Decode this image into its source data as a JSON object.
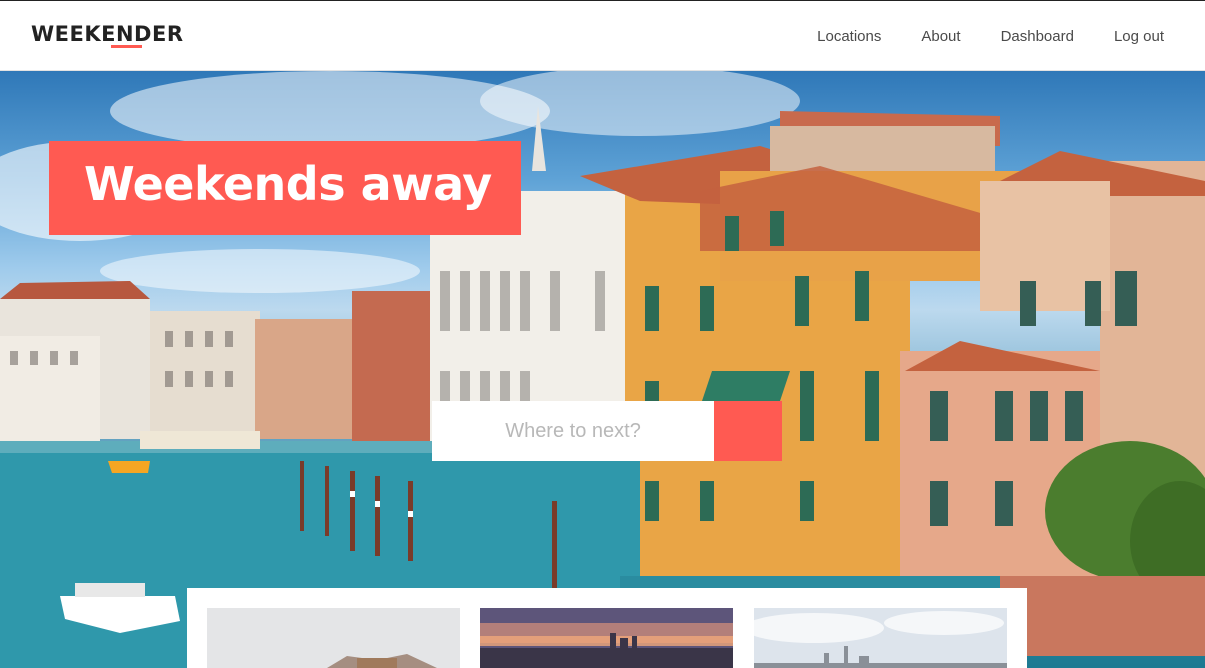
{
  "brand": {
    "name": "WEEKENDER",
    "accent": "#ff5a52"
  },
  "nav": [
    {
      "label": "Locations"
    },
    {
      "label": "About"
    },
    {
      "label": "Dashboard"
    },
    {
      "label": "Log out"
    }
  ],
  "hero": {
    "headline": "Weekends away",
    "search_placeholder": "Where to next?",
    "search_icon": "search-icon"
  },
  "cards": [
    {
      "image": "snowy-landscape-photo"
    },
    {
      "image": "city-sunset-skyline-photo"
    },
    {
      "image": "city-skyline-cloudy-photo"
    }
  ]
}
